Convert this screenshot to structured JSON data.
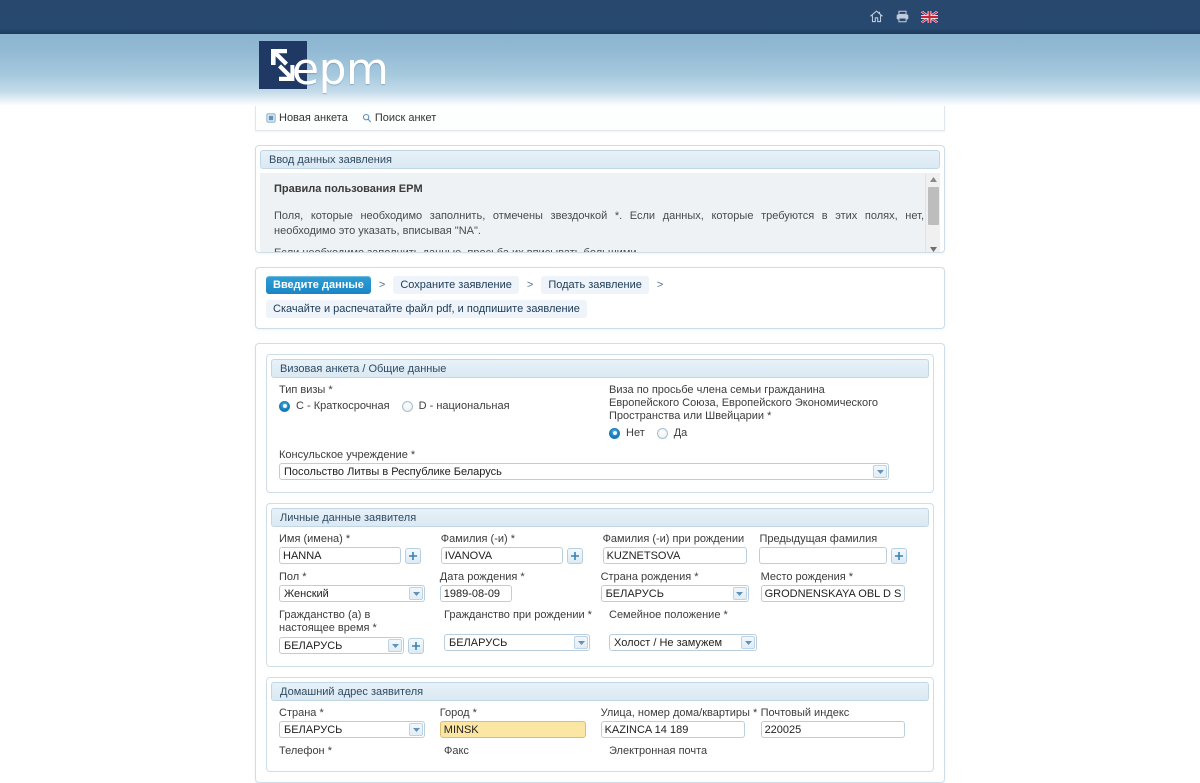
{
  "topbar": {
    "icons": [
      {
        "name": "home-icon",
        "label": "Home"
      },
      {
        "name": "print-icon",
        "label": "Print"
      },
      {
        "name": "uk-flag-icon",
        "label": "English"
      }
    ]
  },
  "brand": {
    "logo_text": "epm",
    "logo_mark": "epm-arrows-logo"
  },
  "menu": {
    "items": [
      {
        "label": "Новая анкета",
        "icon": "new-form-icon"
      },
      {
        "label": "Поиск анкет",
        "icon": "search-icon"
      }
    ]
  },
  "rules": {
    "title": "Ввод данных заявления",
    "heading": "Правила пользования EPM",
    "paragraphs": [
      "Поля, которые необходимо заполнить, отмечены звездочкой *. Если данных, которые требуются в этих полях, нет, необходимо это указать, вписывая \"NA\".",
      "Если необходимо заполнить данные, просьба их вписывать большими"
    ]
  },
  "steps": {
    "items": [
      {
        "label": "Введите данные",
        "active": true
      },
      {
        "label": "Сохраните заявление",
        "active": false
      },
      {
        "label": "Подать заявление",
        "active": false
      },
      {
        "label": "Скачайте и распечатайте файл pdf, и подпишите заявление",
        "active": false
      }
    ],
    "separator": ">"
  },
  "sections": {
    "visa": {
      "title": "Визовая анкета / Общие данные",
      "visa_type_label": "Тип визы *",
      "visa_type_options": [
        {
          "label": "C - Краткосрочная",
          "selected": true
        },
        {
          "label": "D - национальная",
          "selected": false
        }
      ],
      "family_member_label": "Виза по просьбе члена семьи гражданина Европейского Союза, Европейского Экономического Пространства или Швейцарии *",
      "family_member_options": [
        {
          "label": "Нет",
          "selected": true
        },
        {
          "label": "Да",
          "selected": false
        }
      ],
      "consulate_label": "Консульское учреждение *",
      "consulate_value": "Посольство Литвы в Республике Беларусь"
    },
    "personal": {
      "title": "Личные данные заявителя",
      "first_name_label": "Имя (имена) *",
      "first_name_value": "HANNA",
      "surname_label": "Фамилия (-и) *",
      "surname_value": "IVANOVA",
      "birth_surname_label": "Фамилия (-и) при рождении",
      "birth_surname_value": "KUZNETSOVA",
      "previous_surname_label": "Предыдущая фамилия",
      "previous_surname_value": "",
      "sex_label": "Пол *",
      "sex_value": "Женский",
      "dob_label": "Дата рождения *",
      "dob_value": "1989-08-09",
      "country_birth_label": "Страна рождения *",
      "country_birth_value": "БЕЛАРУСЬ",
      "place_birth_label": "Место рождения *",
      "place_birth_value": "GRODNENSKAYA OBL D STYP",
      "citizenship_now_label": "Гражданство (а) в настоящее время *",
      "citizenship_now_value": "БЕЛАРУСЬ",
      "citizenship_birth_label": "Гражданство при рождении *",
      "citizenship_birth_value": "БЕЛАРУСЬ",
      "marital_label": "Семейное положение *",
      "marital_value": "Холост / Не замужем"
    },
    "address": {
      "title": "Домашний адрес заявителя",
      "country_label": "Страна *",
      "country_value": "БЕЛАРУСЬ",
      "city_label": "Город *",
      "city_value": "MINSK",
      "street_label": "Улица, номер дома/квартиры *",
      "street_value": "KAZINCA 14 189",
      "zip_label": "Почтовый индекс",
      "zip_value": "220025",
      "phone_label": "Телефон *",
      "fax_label": "Факс",
      "email_label": "Электронная почта"
    }
  },
  "colors": {
    "topbar": "#27486f",
    "header_blue": "#8ab4d0",
    "accent": "#1b85c4",
    "highlight_field": "#fce6a4",
    "panel_border": "#cfdde8"
  }
}
